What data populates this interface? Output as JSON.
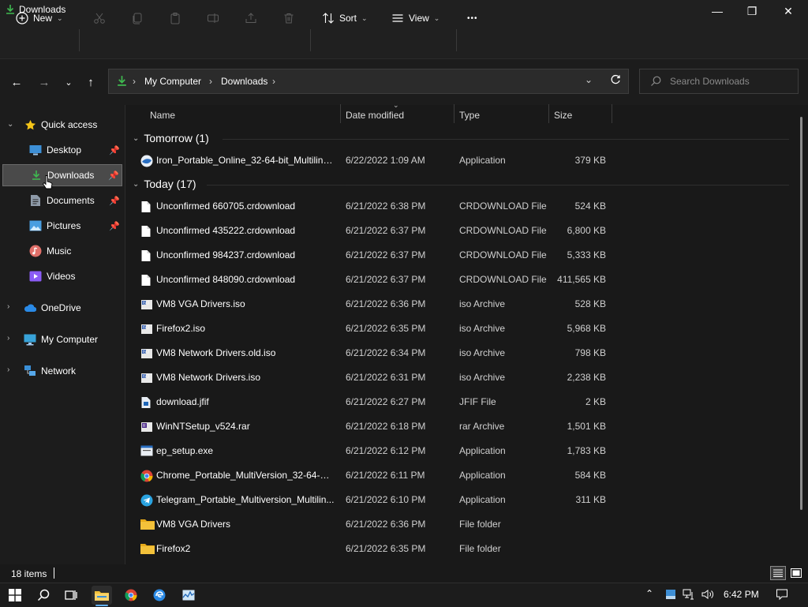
{
  "window": {
    "title": "Downloads",
    "minimize": "—",
    "restore": "❐",
    "close": "✕"
  },
  "toolbar": {
    "new_label": "New",
    "sort_label": "Sort",
    "view_label": "View",
    "more_label": "•••"
  },
  "address": {
    "crumbs": [
      "My Computer",
      "Downloads"
    ],
    "separator": "›"
  },
  "search": {
    "placeholder": "Search Downloads"
  },
  "sidebar": {
    "quick_access": "Quick access",
    "items": [
      {
        "label": "Desktop",
        "icon": "desktop-icon"
      },
      {
        "label": "Downloads",
        "icon": "download-icon"
      },
      {
        "label": "Documents",
        "icon": "document-icon"
      },
      {
        "label": "Pictures",
        "icon": "pictures-icon"
      },
      {
        "label": "Music",
        "icon": "music-icon"
      },
      {
        "label": "Videos",
        "icon": "videos-icon"
      }
    ],
    "onedrive": "OneDrive",
    "my_computer": "My Computer",
    "network": "Network"
  },
  "columns": {
    "name": "Name",
    "date": "Date modified",
    "type": "Type",
    "size": "Size"
  },
  "groups": [
    {
      "label": "Tomorrow (1)",
      "files": [
        {
          "name": "Iron_Portable_Online_32-64-bit_Multiling...",
          "date": "6/22/2022 1:09 AM",
          "type": "Application",
          "size": "379 KB",
          "icon": "iron-icon"
        }
      ]
    },
    {
      "label": "Today (17)",
      "files": [
        {
          "name": "Unconfirmed 660705.crdownload",
          "date": "6/21/2022 6:38 PM",
          "type": "CRDOWNLOAD File",
          "size": "524 KB",
          "icon": "file-icon"
        },
        {
          "name": "Unconfirmed 435222.crdownload",
          "date": "6/21/2022 6:37 PM",
          "type": "CRDOWNLOAD File",
          "size": "6,800 KB",
          "icon": "file-icon"
        },
        {
          "name": "Unconfirmed 984237.crdownload",
          "date": "6/21/2022 6:37 PM",
          "type": "CRDOWNLOAD File",
          "size": "5,333 KB",
          "icon": "file-icon"
        },
        {
          "name": "Unconfirmed 848090.crdownload",
          "date": "6/21/2022 6:37 PM",
          "type": "CRDOWNLOAD File",
          "size": "411,565 KB",
          "icon": "file-icon"
        },
        {
          "name": "VM8 VGA Drivers.iso",
          "date": "6/21/2022 6:36 PM",
          "type": "iso Archive",
          "size": "528 KB",
          "icon": "iso-icon"
        },
        {
          "name": "Firefox2.iso",
          "date": "6/21/2022 6:35 PM",
          "type": "iso Archive",
          "size": "5,968 KB",
          "icon": "iso-icon"
        },
        {
          "name": "VM8 Network Drivers.old.iso",
          "date": "6/21/2022 6:34 PM",
          "type": "iso Archive",
          "size": "798 KB",
          "icon": "iso-icon"
        },
        {
          "name": "VM8 Network Drivers.iso",
          "date": "6/21/2022 6:31 PM",
          "type": "iso Archive",
          "size": "2,238 KB",
          "icon": "iso-icon"
        },
        {
          "name": "download.jfif",
          "date": "6/21/2022 6:27 PM",
          "type": "JFIF File",
          "size": "2 KB",
          "icon": "image-file-icon"
        },
        {
          "name": "WinNTSetup_v524.rar",
          "date": "6/21/2022 6:18 PM",
          "type": "rar Archive",
          "size": "1,501 KB",
          "icon": "rar-icon"
        },
        {
          "name": "ep_setup.exe",
          "date": "6/21/2022 6:12 PM",
          "type": "Application",
          "size": "1,783 KB",
          "icon": "exe-icon"
        },
        {
          "name": "Chrome_Portable_MultiVersion_32-64-bit...",
          "date": "6/21/2022 6:11 PM",
          "type": "Application",
          "size": "584 KB",
          "icon": "chrome-icon"
        },
        {
          "name": "Telegram_Portable_Multiversion_Multilin...",
          "date": "6/21/2022 6:10 PM",
          "type": "Application",
          "size": "311 KB",
          "icon": "telegram-icon"
        },
        {
          "name": "VM8 VGA Drivers",
          "date": "6/21/2022 6:36 PM",
          "type": "File folder",
          "size": "",
          "icon": "folder-icon"
        },
        {
          "name": "Firefox2",
          "date": "6/21/2022 6:35 PM",
          "type": "File folder",
          "size": "",
          "icon": "folder-icon"
        }
      ]
    }
  ],
  "status": {
    "count": "18 items"
  },
  "taskbar": {
    "time": "6:42 PM"
  },
  "colors": {
    "accent": "#0078d4",
    "folder": "#f3c13a",
    "download_green": "#3fb950"
  }
}
